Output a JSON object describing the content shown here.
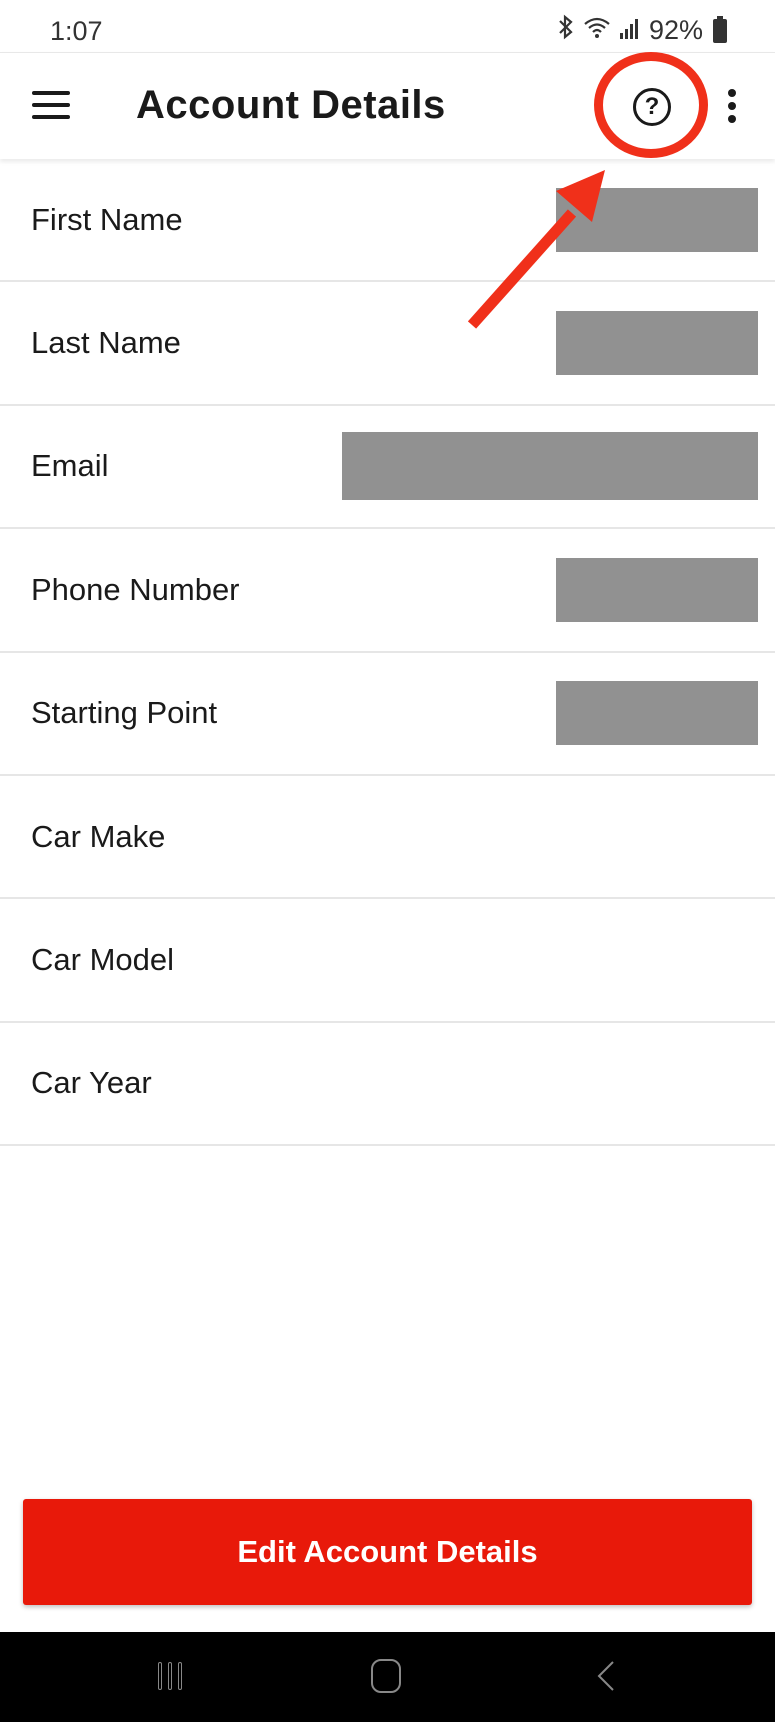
{
  "status_bar": {
    "time": "1:07",
    "battery_percent": "92%",
    "icons": [
      "bluetooth-icon",
      "wifi-icon",
      "signal-icon",
      "battery-icon"
    ]
  },
  "app_bar": {
    "title": "Account Details",
    "menu_icon": "hamburger-menu-icon",
    "help_icon": "?",
    "more_icon": "more-vertical-icon"
  },
  "fields": [
    {
      "label": "First Name",
      "value_redacted": true
    },
    {
      "label": "Last Name",
      "value_redacted": true
    },
    {
      "label": "Email",
      "value_redacted": true
    },
    {
      "label": "Phone Number",
      "value_redacted": true
    },
    {
      "label": "Starting Point",
      "value_redacted": true
    },
    {
      "label": "Car Make",
      "value_redacted": false
    },
    {
      "label": "Car Model",
      "value_redacted": false
    },
    {
      "label": "Car Year",
      "value_redacted": false
    }
  ],
  "actions": {
    "edit_label": "Edit Account Details"
  },
  "colors": {
    "primary_red": "#e8190a",
    "annotation_red": "#f0301a",
    "redaction_gray": "#919191"
  },
  "annotation": {
    "type": "circle-and-arrow",
    "target": "help-button"
  },
  "nav_bar": {
    "buttons": [
      "recent-apps",
      "home",
      "back"
    ]
  }
}
